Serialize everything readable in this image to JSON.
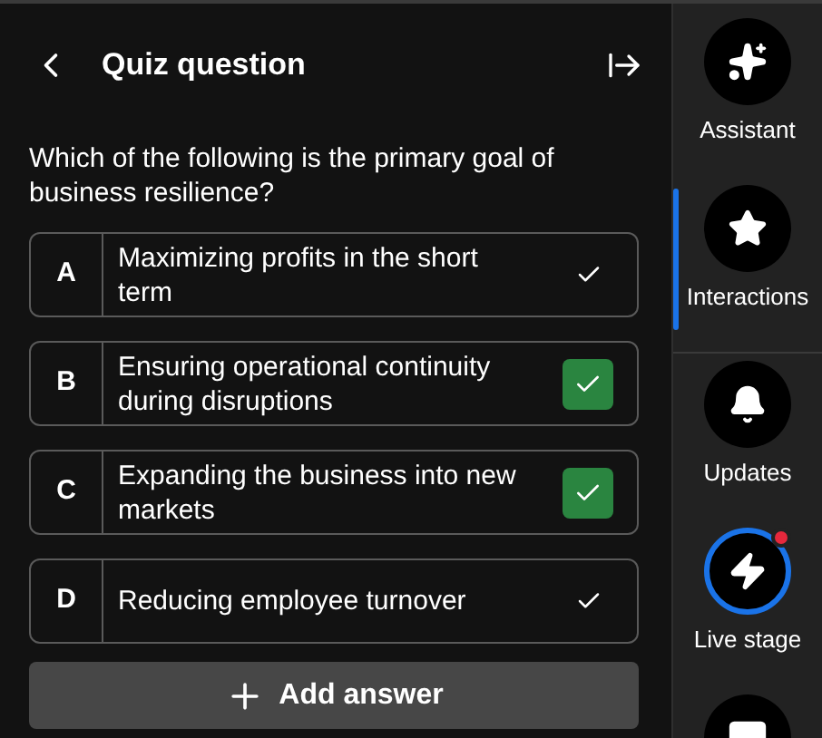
{
  "header": {
    "title": "Quiz question"
  },
  "question": "Which of the following is the primary goal of business resilience?",
  "answers": [
    {
      "letter": "A",
      "text": "Maximizing profits in the short term",
      "correct": false
    },
    {
      "letter": "B",
      "text": "Ensuring operational continuity during disruptions",
      "correct": true
    },
    {
      "letter": "C",
      "text": "Expanding the business into new markets",
      "correct": true
    },
    {
      "letter": "D",
      "text": "Reducing employee turnover",
      "correct": false
    }
  ],
  "add_button": "Add answer",
  "sidebar": {
    "items": [
      {
        "kind": "assistant",
        "label": "Assistant",
        "selected": false,
        "live": false
      },
      {
        "kind": "interactions",
        "label": "Interactions",
        "selected": true,
        "live": false
      },
      {
        "kind": "updates",
        "label": "Updates",
        "selected": false,
        "live": false
      },
      {
        "kind": "live",
        "label": "Live stage",
        "selected": false,
        "live": true
      },
      {
        "kind": "chat",
        "selected": false,
        "live": false
      }
    ]
  }
}
